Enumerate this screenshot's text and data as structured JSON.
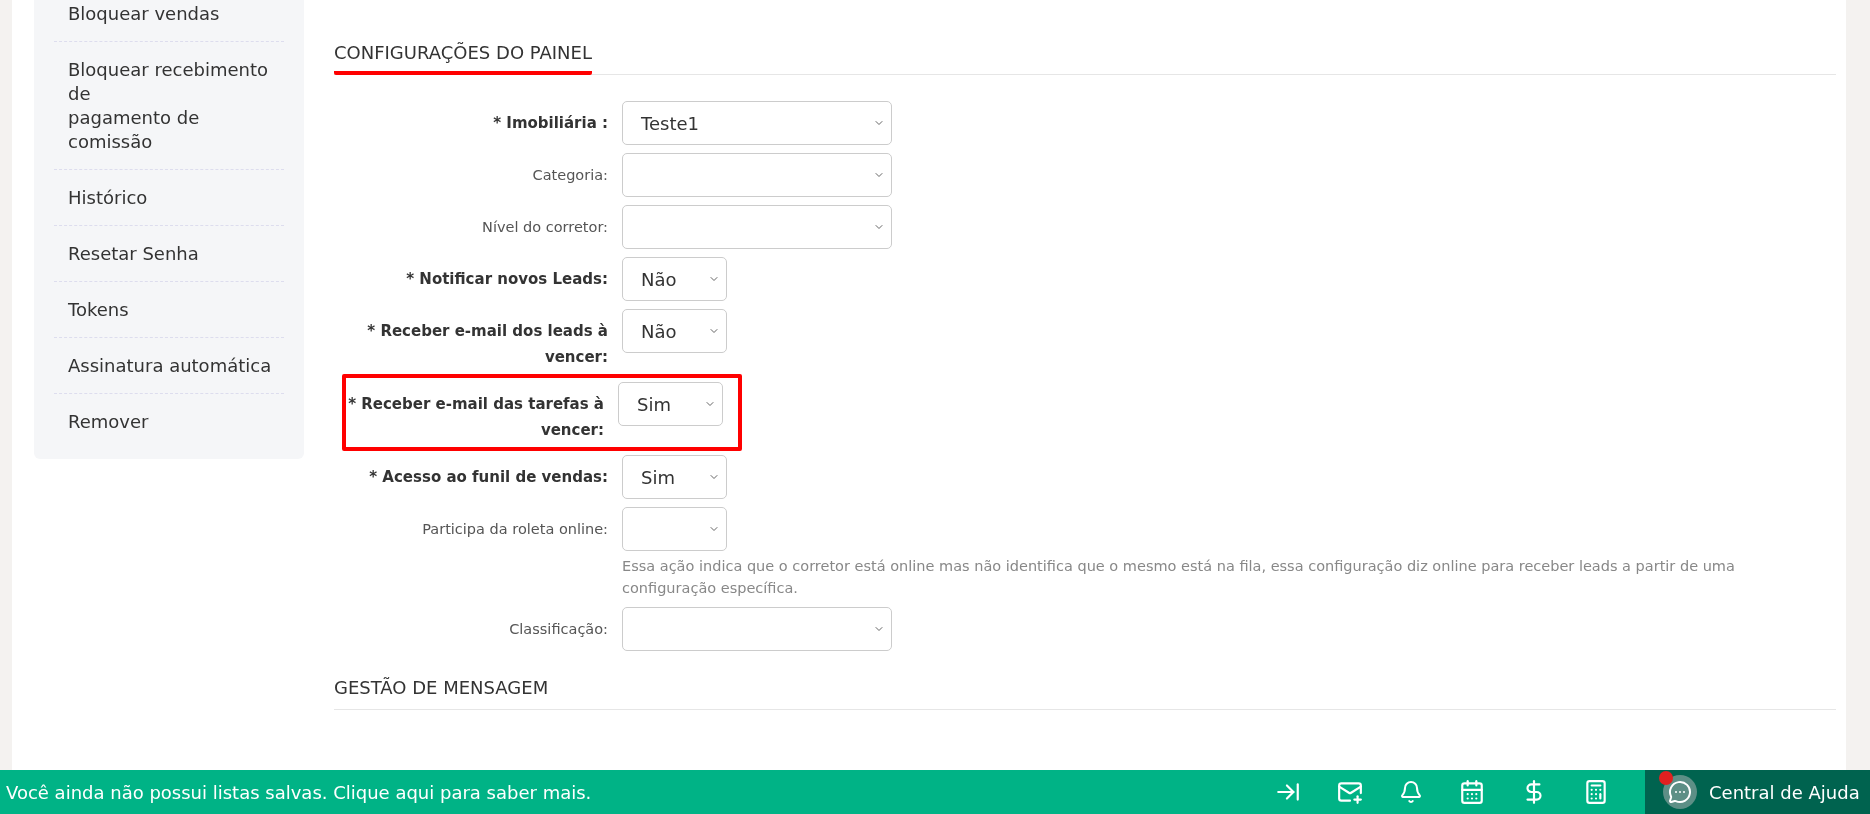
{
  "sidebar": {
    "items": [
      {
        "label": "Bloquear vendas"
      },
      {
        "label": "Bloquear recebimento\nde\npagamento de\ncomissão"
      },
      {
        "label": "Histórico"
      },
      {
        "label": "Resetar Senha"
      },
      {
        "label": "Tokens"
      },
      {
        "label": "Assinatura automática"
      },
      {
        "label": "Remover"
      }
    ]
  },
  "sections": [
    {
      "title": "CONFIGURAÇÕES DO PAINEL",
      "highlighted": true,
      "fields": [
        {
          "label": "* Imobiliária :",
          "required": true,
          "value": "Teste1",
          "kind": "wide",
          "highlighted": false
        },
        {
          "label": "Categoria:",
          "required": false,
          "kind": "wide",
          "highlighted": false
        },
        {
          "label": "Nível do corretor:",
          "required": false,
          "kind": "wide",
          "highlighted": false
        },
        {
          "label": "* Notificar novos Leads:",
          "required": true,
          "value": "Não",
          "kind": "small",
          "highlighted": false
        },
        {
          "label": "* Receber e-mail dos leads à vencer:",
          "required": true,
          "value": "Não",
          "kind": "small",
          "highlighted": false
        },
        {
          "label": "* Receber e-mail das tarefas à vencer:",
          "required": true,
          "value": "Sim",
          "kind": "small",
          "highlighted": true
        },
        {
          "label": "* Acesso ao funil de vendas:",
          "required": true,
          "value": "Sim",
          "kind": "small",
          "highlighted": false
        },
        {
          "label": "Participa da roleta online:",
          "required": false,
          "kind": "small",
          "highlighted": false,
          "help": "Essa ação indica que o corretor está online mas não identifica que o mesmo está na fila, essa configuração diz online para receber leads a partir de uma configuração específica."
        },
        {
          "label": "Classificação:",
          "required": false,
          "kind": "wide",
          "highlighted": false
        }
      ]
    },
    {
      "title": "GESTÃO DE MENSAGEM",
      "highlighted": false
    }
  ],
  "footer": {
    "message": "Você ainda não possui listas salvas. Clique aqui para saber mais.",
    "help_label": "Central de Ajuda",
    "help_notification": true
  }
}
